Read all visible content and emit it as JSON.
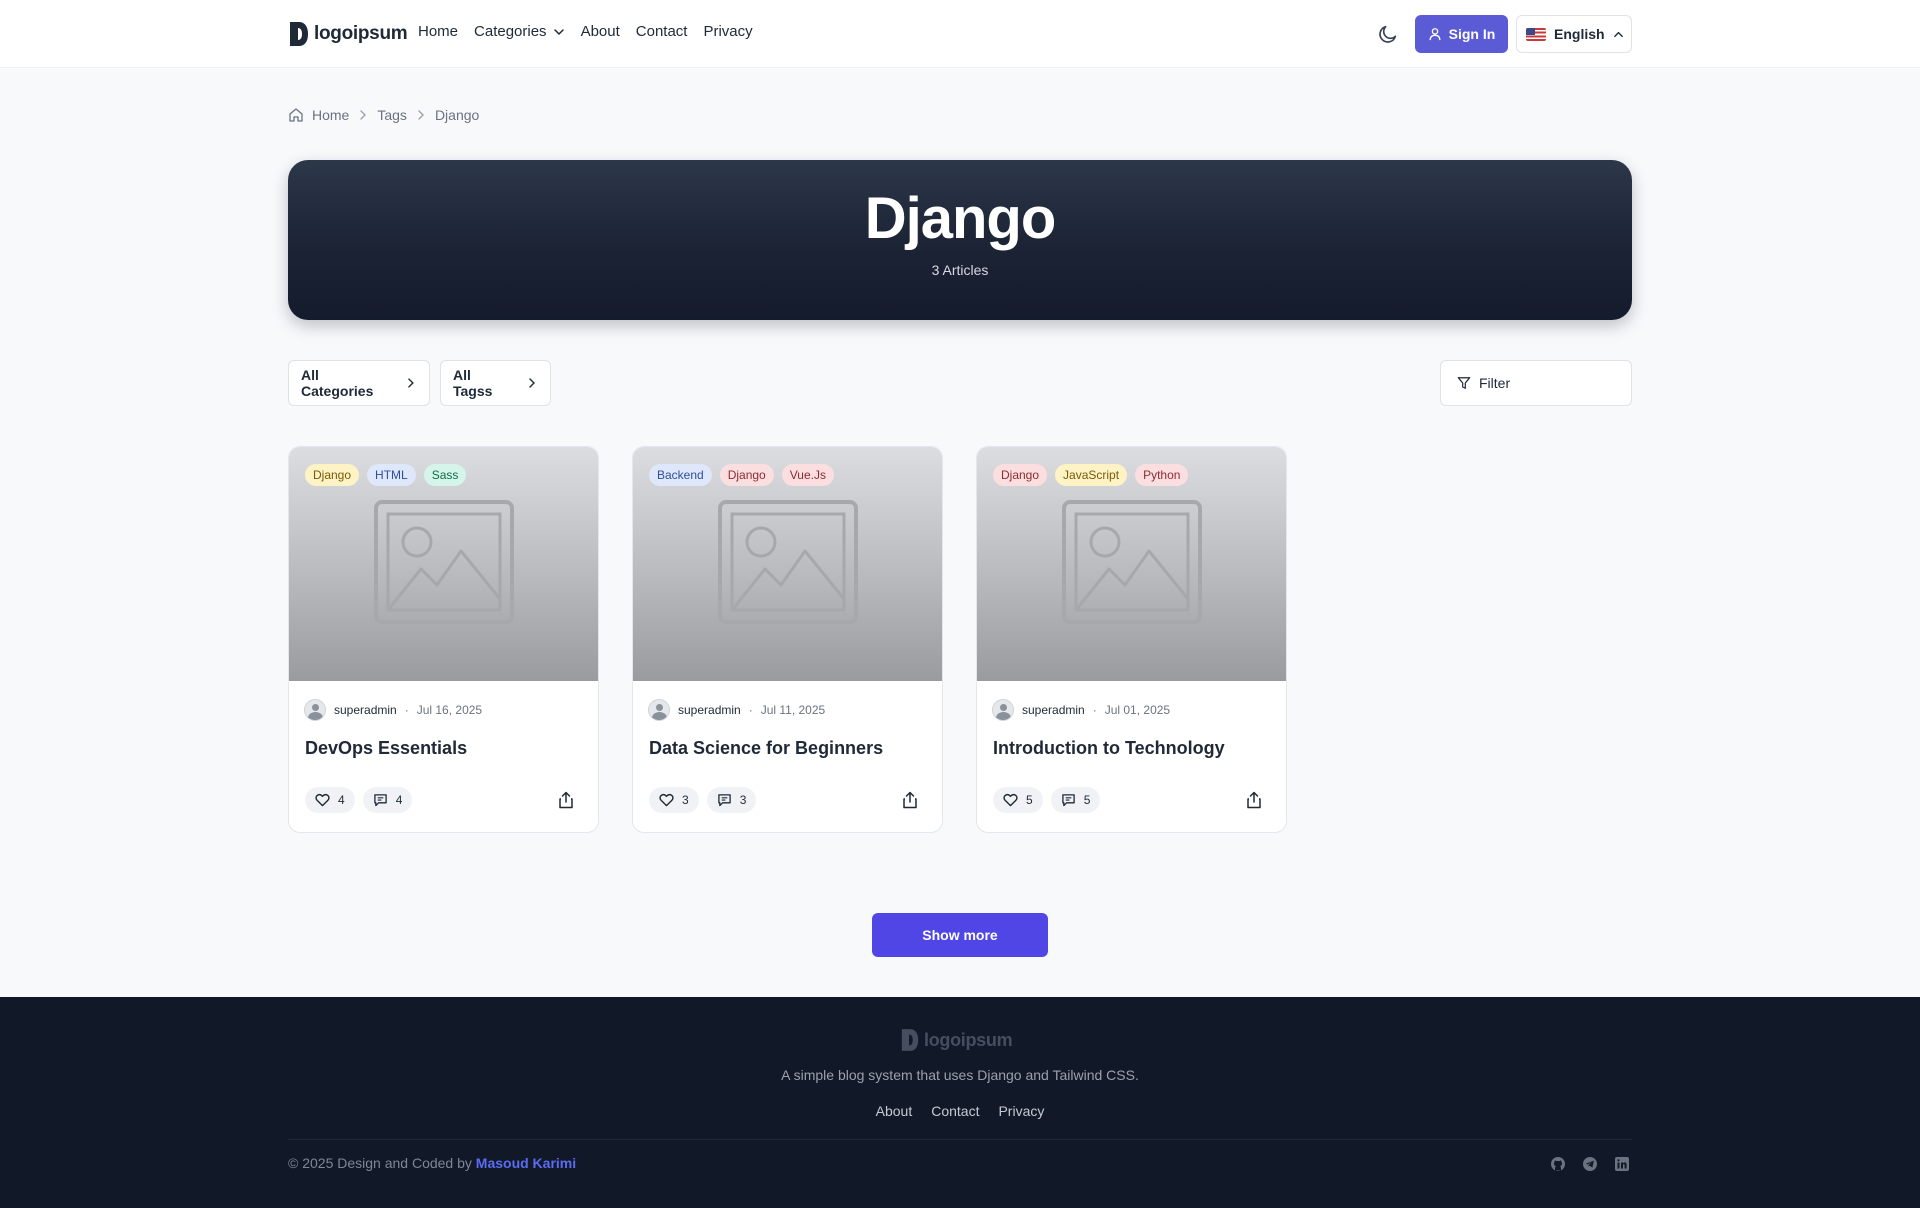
{
  "header": {
    "logo_text": "logoipsum",
    "nav": [
      {
        "label": "Home"
      },
      {
        "label": "Categories"
      },
      {
        "label": "About"
      },
      {
        "label": "Contact"
      },
      {
        "label": "Privacy"
      }
    ],
    "signin_label": "Sign In",
    "language_label": "English"
  },
  "breadcrumb": [
    "Home",
    "Tags",
    "Django"
  ],
  "hero": {
    "title": "Django",
    "subtitle": "3 Articles"
  },
  "filters": {
    "categories_label": "All Categories",
    "tags_label": "All Tagss",
    "filter_label": "Filter"
  },
  "cards": [
    {
      "tags": [
        {
          "label": "Django",
          "bg": "#fdf3c4",
          "fg": "#7a5a08"
        },
        {
          "label": "HTML",
          "bg": "#dfe8fb",
          "fg": "#2f4e9c"
        },
        {
          "label": "Sass",
          "bg": "#d5f5ea",
          "fg": "#0f6b4a"
        }
      ],
      "author": "superadmin",
      "date": "Jul 16, 2025",
      "title": "DevOps Essentials",
      "likes": "4",
      "comments": "4"
    },
    {
      "tags": [
        {
          "label": "Backend",
          "bg": "#dfe8fb",
          "fg": "#2f4e9c"
        },
        {
          "label": "Django",
          "bg": "#fbdfe0",
          "fg": "#8e2b31"
        },
        {
          "label": "Vue.Js",
          "bg": "#fbdfe0",
          "fg": "#8e2b31"
        }
      ],
      "author": "superadmin",
      "date": "Jul 11, 2025",
      "title": "Data Science for Beginners",
      "likes": "3",
      "comments": "3"
    },
    {
      "tags": [
        {
          "label": "Django",
          "bg": "#fbdfe0",
          "fg": "#8e2b31"
        },
        {
          "label": "JavaScript",
          "bg": "#fdf3c4",
          "fg": "#7a5a08"
        },
        {
          "label": "Python",
          "bg": "#fbdfe0",
          "fg": "#8e2b31"
        }
      ],
      "author": "superadmin",
      "date": "Jul 01, 2025",
      "title": "Introduction to Technology",
      "likes": "5",
      "comments": "5"
    }
  ],
  "show_more_label": "Show more",
  "footer": {
    "logo_text": "logoipsum",
    "tagline": "A simple blog system that uses Django and Tailwind CSS.",
    "links": [
      "About",
      "Contact",
      "Privacy"
    ],
    "copyright_prefix": "© 2025 Design and Coded by",
    "author": "Masoud Karimi"
  },
  "colors": {
    "primary": "#5b5bd6",
    "show_more": "#4f46e5",
    "footer_bg": "#111828",
    "hero_bg": "#1b2335"
  },
  "icons": [
    "logo-mark",
    "chevron-down-icon",
    "moon-icon",
    "user-icon",
    "us-flag-icon",
    "chevron-up-icon",
    "home-icon",
    "chevron-right-icon",
    "filter-icon",
    "image-placeholder-icon",
    "heart-icon",
    "comment-icon",
    "share-icon",
    "github-icon",
    "telegram-icon",
    "linkedin-icon"
  ]
}
